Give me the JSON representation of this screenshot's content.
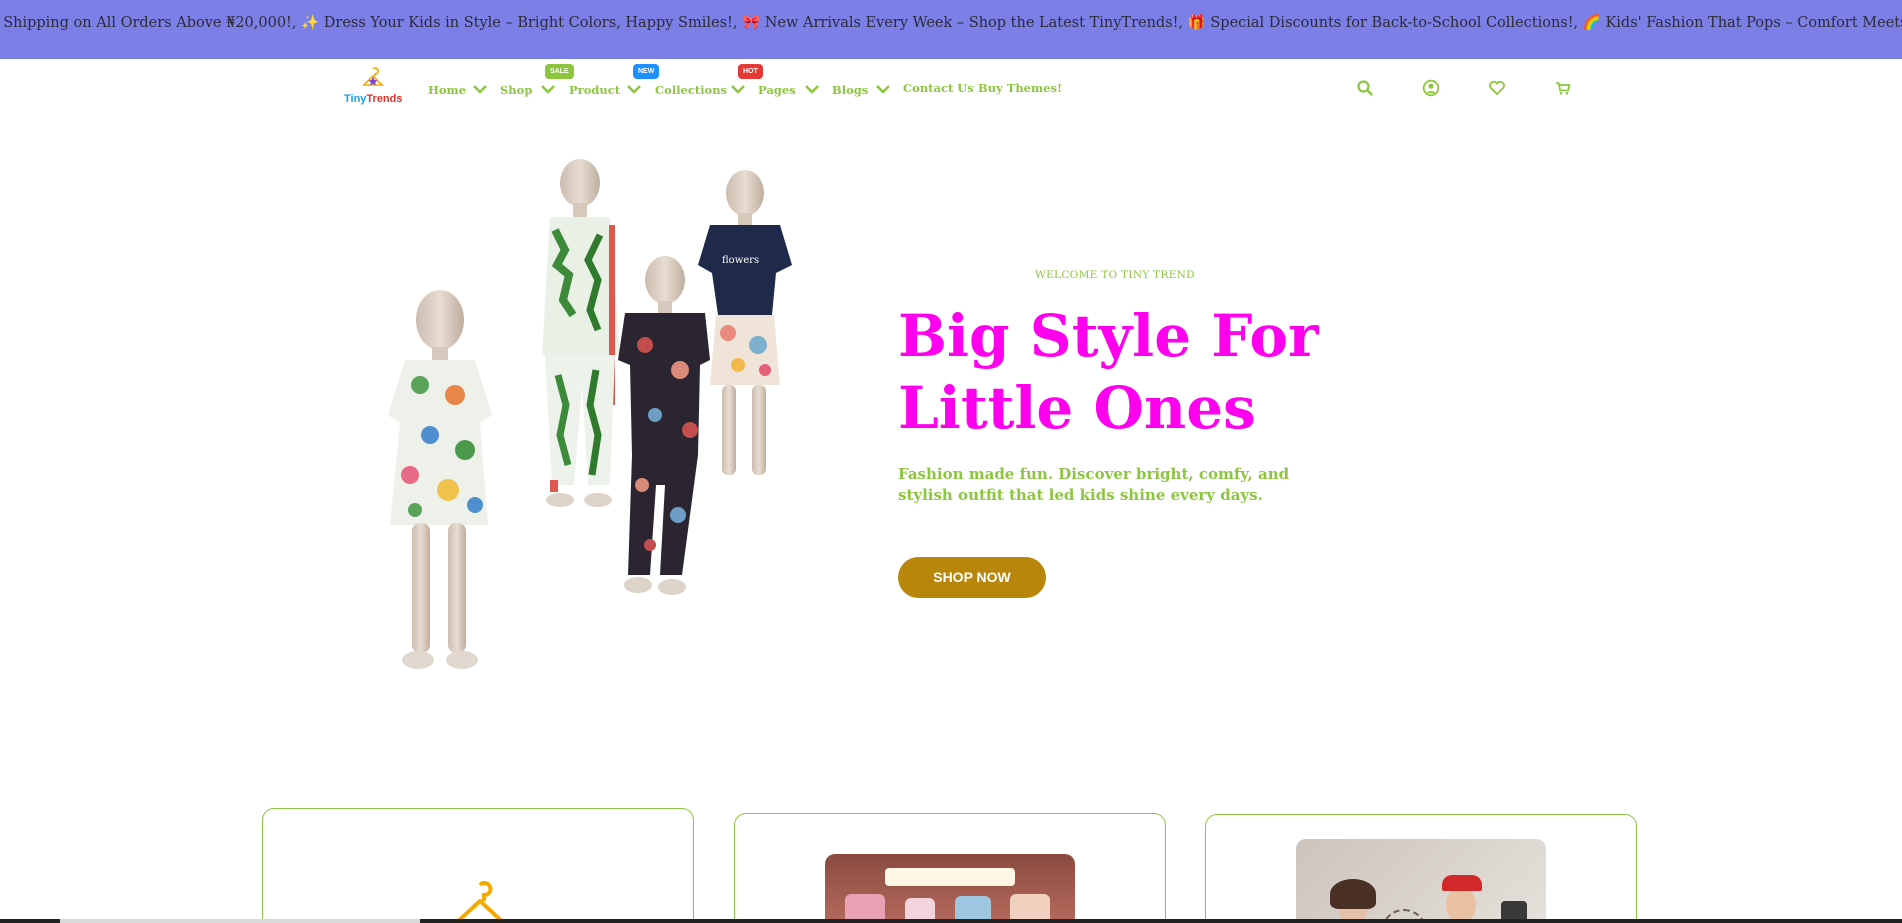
{
  "announcement": {
    "text": "e Shipping on All Orders Above ₦20,000!, ✨ Dress Your Kids in Style – Bright Colors, Happy Smiles!, 🎀 New Arrivals Every Week – Shop the Latest TinyTrends!, 🎁 Special Discounts for Back-to-School Collections!, 🌈 Kids' Fashion That Pops – Comfort Meets Style!"
  },
  "brand": {
    "tiny": "Tiny",
    "trends": "Trends"
  },
  "nav": {
    "home": "Home",
    "shop": "Shop",
    "product": "Product",
    "collections": "Collections",
    "pages": "Pages",
    "blogs": "Blogs",
    "contact": "Contact Us",
    "buy": "Buy Themes!",
    "badge_sale": "SALE",
    "badge_new": "NEW",
    "badge_hot": "HOT"
  },
  "header_icons": [
    "search-icon",
    "account-icon",
    "wishlist-icon",
    "cart-icon"
  ],
  "hero": {
    "eyebrow": "WELCOME TO TINY TREND",
    "headline_line1": "Big Style For",
    "headline_line2": "Little Ones",
    "subtext": "Fashion made fun. Discover bright, comfy, and stylish outfit that led kids shine every days.",
    "cta": "SHOP NOW"
  },
  "colors": {
    "announcement_bg": "#7b7fe6",
    "accent_green": "#8cc63f",
    "headline_magenta": "#ff00ee",
    "cta_gold": "#b8860b"
  }
}
